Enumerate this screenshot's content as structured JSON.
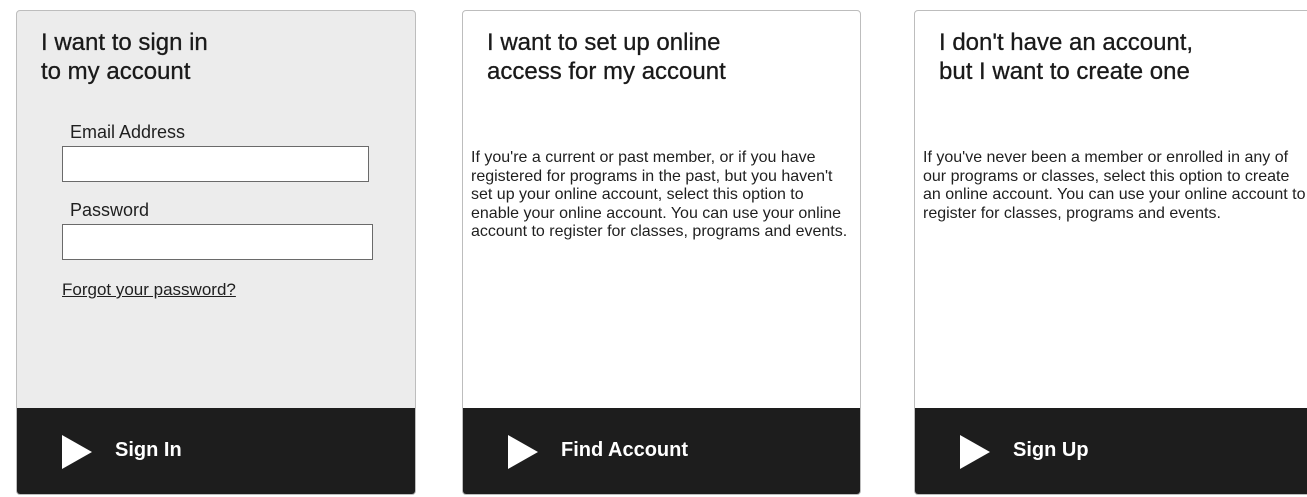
{
  "signin": {
    "title_line1": "I want to sign in",
    "title_line2": "to my account",
    "email_label": "Email Address",
    "email_value": "",
    "password_label": "Password",
    "password_value": "",
    "forgot_link": "Forgot your password?",
    "action_label": "Sign In",
    "action_icon": "play-arrow-icon"
  },
  "find_account": {
    "title_line1": "I want to set up online",
    "title_line2": "access for my account",
    "description": "If you're a current or past member, or if you have registered for programs in the past, but you haven't set up your online account, select this option to enable your online account. You can use your online account to register for classes, programs and events.",
    "action_label": "Find Account",
    "action_icon": "play-arrow-icon"
  },
  "create_account": {
    "title_line1": "I don't have an account,",
    "title_line2": "but I want to create one",
    "description": "If you've never been a member or enrolled in any of our programs or classes, select this option to create an online account. You can use your online account to register for classes, programs and events.",
    "action_label": "Sign Up",
    "action_icon": "play-arrow-icon"
  },
  "colors": {
    "signin_card_bg": "#ececec",
    "action_bar_bg": "#1d1d1d",
    "action_text": "#ffffff"
  }
}
